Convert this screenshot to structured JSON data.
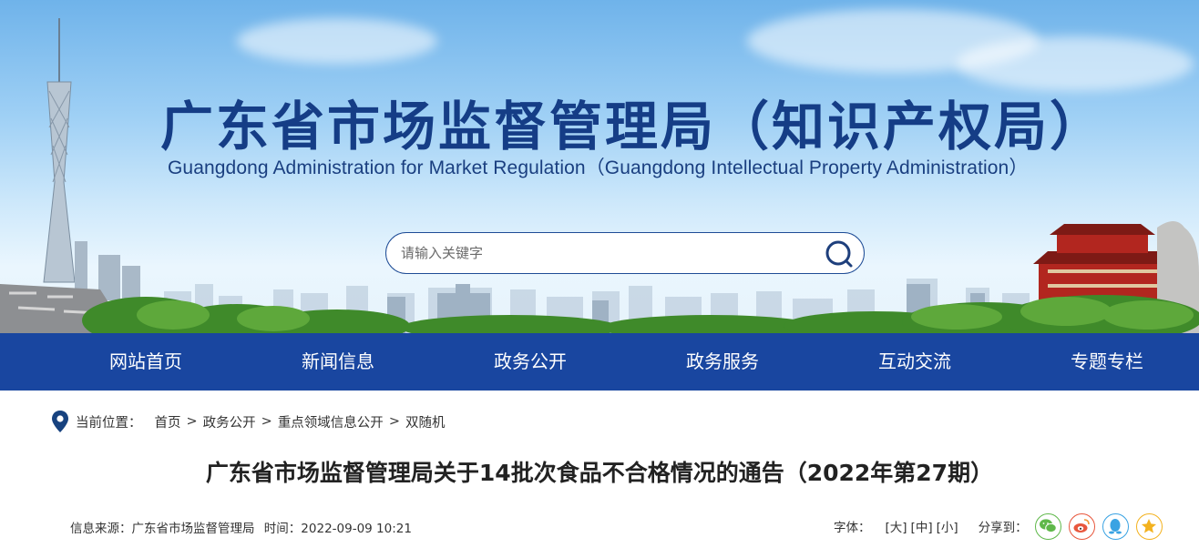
{
  "header": {
    "title_cn": "广东省市场监督管理局（知识产权局）",
    "title_en": "Guangdong Administration for Market Regulation（Guangdong Intellectual Property Administration）"
  },
  "search": {
    "placeholder": "请输入关键字",
    "icon": "search-icon"
  },
  "nav": {
    "items": [
      {
        "label": "网站首页"
      },
      {
        "label": "新闻信息"
      },
      {
        "label": "政务公开"
      },
      {
        "label": "政务服务"
      },
      {
        "label": "互动交流"
      },
      {
        "label": "专题专栏"
      }
    ]
  },
  "breadcrumb": {
    "prefix": "当前位置：",
    "items": [
      "首页",
      "政务公开",
      "重点领域信息公开",
      "双随机"
    ],
    "separator": ">"
  },
  "article": {
    "title": "广东省市场监督管理局关于14批次食品不合格情况的通告（2022年第27期）",
    "source_label": "信息来源：",
    "source": "广东省市场监督管理局",
    "time_label": "时间：",
    "time": "2022-09-09 10:21"
  },
  "tools": {
    "font_label": "字体：",
    "font_large": "[大]",
    "font_medium": "[中]",
    "font_small": "[小]",
    "share_label": "分享到：",
    "share_icons": [
      "wechat-icon",
      "weibo-icon",
      "qq-icon",
      "qzone-icon"
    ]
  },
  "colors": {
    "nav_bg": "#1946a0",
    "title_blue": "#153d86",
    "wechat": "#5fb84a",
    "weibo": "#e8573d",
    "qq": "#3aa3e3",
    "qzone": "#f3b21f"
  }
}
